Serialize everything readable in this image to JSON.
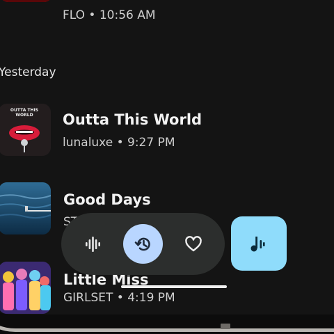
{
  "list": {
    "top_item": {
      "subtitle": "FLO • 10:56 AM",
      "art_icon": "album-art-flo"
    },
    "section_header": "Yesterday",
    "items": [
      {
        "title": "Outta This World",
        "subtitle": "lunaluxe • 9:27 PM",
        "art_text": "OUTTA THIS WORLD",
        "art_icon": "album-art-lips"
      },
      {
        "title": "Good Days",
        "subtitle": "ST",
        "art_icon": "album-art-ocean"
      },
      {
        "title": "Little Miss",
        "subtitle": "GIRLSET • 4:19 PM",
        "art_icon": "album-art-group"
      }
    ]
  },
  "bottom_bar": {
    "buttons": [
      {
        "icon": "waveform-icon",
        "selected": false
      },
      {
        "icon": "history-icon",
        "selected": true
      },
      {
        "icon": "heart-icon",
        "selected": false
      }
    ],
    "fab_icon": "music-note-waveform-icon"
  },
  "colors": {
    "background": "#141414",
    "pill_background": "#2c2e2d",
    "selected_circle": "#b9d6ff",
    "fab": "#8fdcfb",
    "fab_icon": "#0b2b3a",
    "title_text": "#f2f2f2",
    "subtitle_text": "#cfcfcf"
  }
}
